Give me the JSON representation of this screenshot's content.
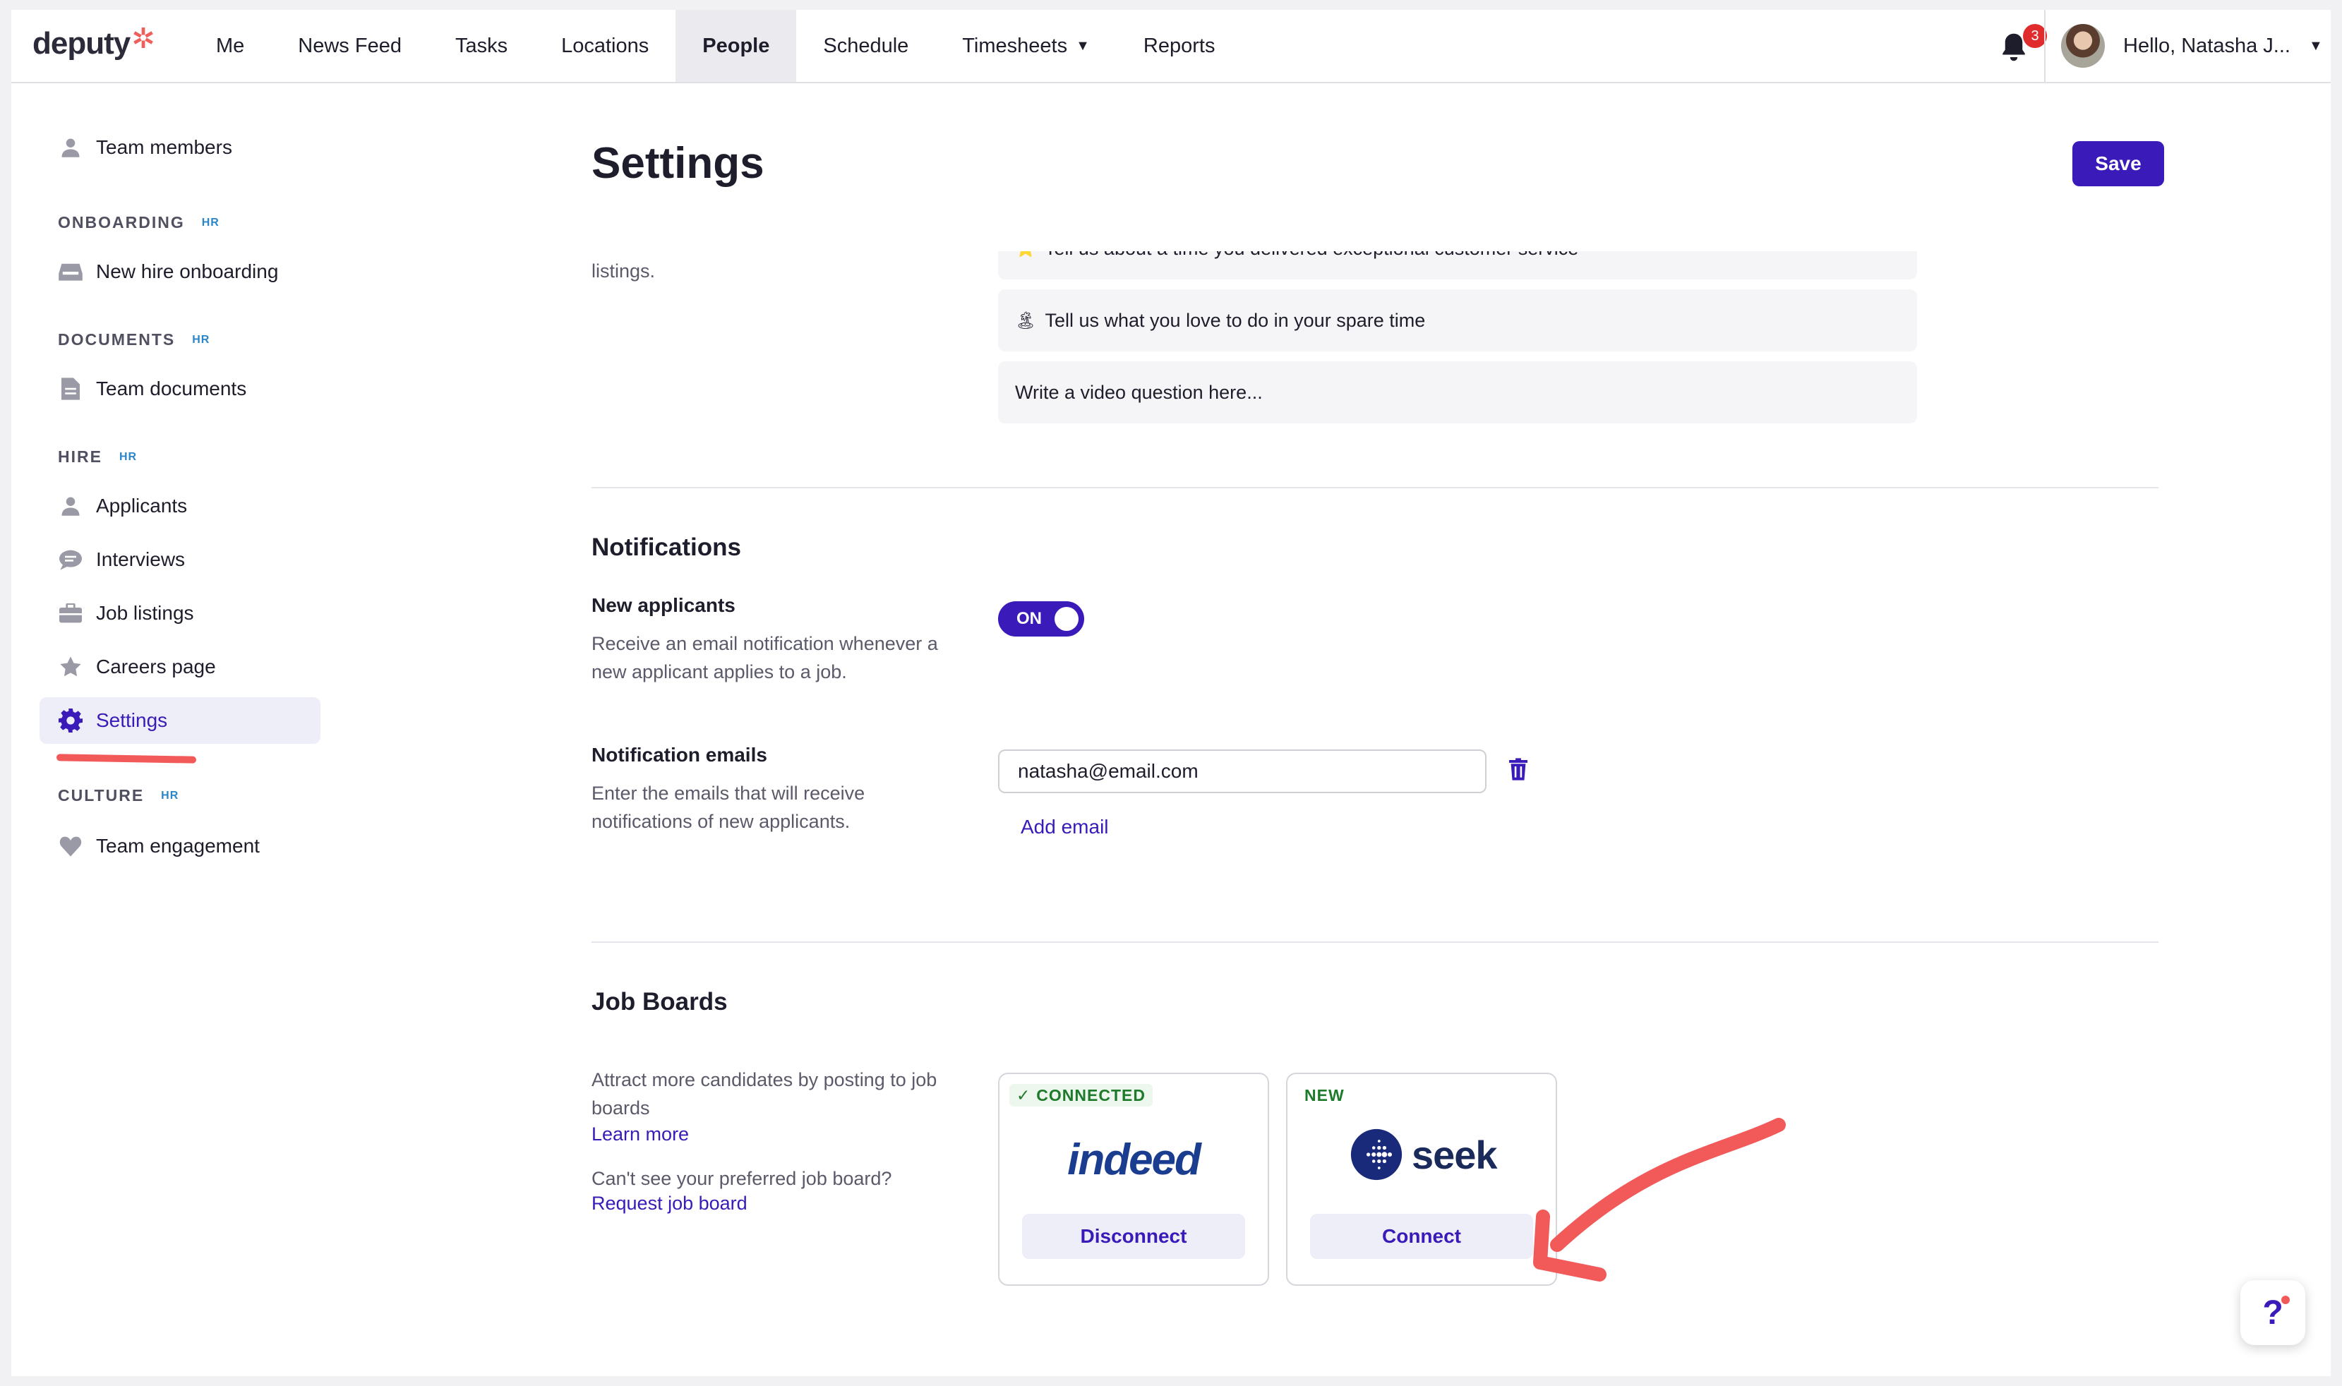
{
  "nav": {
    "logo_text": "deputy",
    "items": [
      {
        "label": "Me"
      },
      {
        "label": "News Feed"
      },
      {
        "label": "Tasks"
      },
      {
        "label": "Locations"
      },
      {
        "label": "People"
      },
      {
        "label": "Schedule"
      },
      {
        "label": "Timesheets"
      },
      {
        "label": "Reports"
      }
    ],
    "active": "People",
    "notification_count": "3",
    "greeting": "Hello, Natasha J..."
  },
  "sidebar": {
    "team_members": "Team members",
    "onboarding_head": "ONBOARDING",
    "new_hire_onboarding": "New hire onboarding",
    "documents_head": "DOCUMENTS",
    "team_documents": "Team documents",
    "hire_head": "HIRE",
    "applicants": "Applicants",
    "interviews": "Interviews",
    "job_listings": "Job listings",
    "careers_page": "Careers page",
    "settings": "Settings",
    "culture_head": "CULTURE",
    "team_engagement": "Team engagement",
    "hr_badge": "HR"
  },
  "main": {
    "title": "Settings",
    "save_label": "Save",
    "listings_fragment": "listings.",
    "questions": [
      {
        "emoji": "⭐",
        "text": "Tell us about a time you delivered exceptional customer service"
      },
      {
        "emoji": "🏝",
        "text": "Tell us what you love to do in your spare time"
      },
      {
        "emoji": "",
        "text": "Write a video question here..."
      }
    ],
    "notifications": {
      "title": "Notifications",
      "new_applicants_label": "New applicants",
      "new_applicants_desc": "Receive an email notification whenever a new applicant applies to a job.",
      "toggle_label": "ON",
      "emails_label": "Notification emails",
      "emails_desc": "Enter the emails that will receive notifications of new applicants.",
      "email_value": "natasha@email.com",
      "add_email": "Add email"
    },
    "job_boards": {
      "title": "Job Boards",
      "desc": "Attract more candidates by posting to job boards",
      "learn_more": "Learn more",
      "cant_see": "Can't see your preferred job board?",
      "request": "Request job board",
      "indeed": {
        "tag": "CONNECTED",
        "logo": "indeed",
        "button": "Disconnect"
      },
      "seek": {
        "tag": "NEW",
        "logo": "seek",
        "button": "Connect"
      }
    }
  },
  "help_label": "?",
  "colors": {
    "accent": "#3a1ab8",
    "annotation": "#f25a5a"
  }
}
